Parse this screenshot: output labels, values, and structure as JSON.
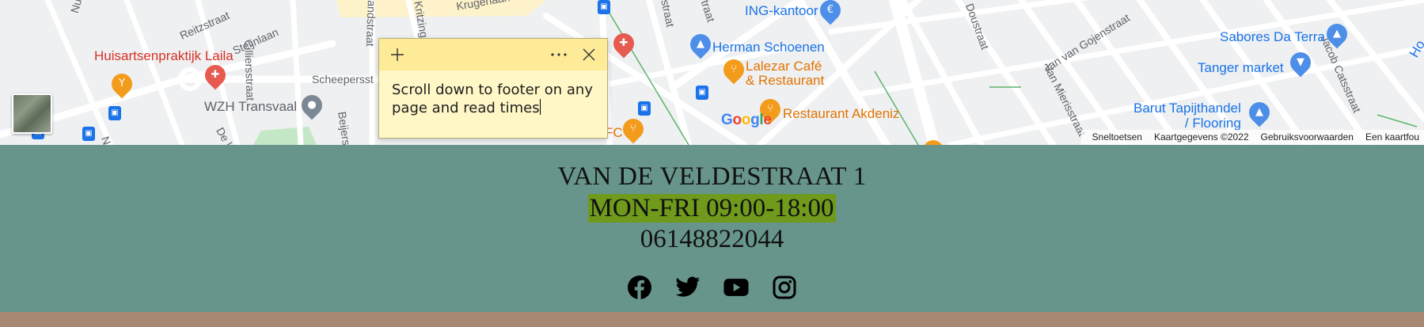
{
  "map": {
    "streets": [
      "Nunsp",
      "Reitzstraat",
      "Steijnlaan",
      "Cilliersstraat",
      "randstraat",
      "Kritzing",
      "Krugerlaan",
      "straat",
      "traat",
      "Doustraat",
      "Jan van Gojenstraat",
      "Van Mierisstraat",
      "Jacob Catsstraat",
      "Scheepersst",
      "Beijers",
      "De l",
      "N"
    ],
    "pois": {
      "laila": "Huisartsenpraktijk Laila",
      "wzh": "WZH Transvaal",
      "ing": "ING-kantoor",
      "herman": "Herman Schoenen",
      "lalezar": "Lalezar Café\n& Restaurant",
      "akdeniz": "Restaurant Akdeniz",
      "sabores": "Sabores Da Terra",
      "tanger": "Tanger market",
      "barut": "Barut Tapijthandel\n/ Flooring",
      "kfc_fragment": "FC",
      "hoo": "Ho"
    },
    "google_logo": "Google",
    "attribution": {
      "shortcuts": "Sneltoetsen",
      "map_data": "Kaartgegevens ©2022",
      "terms": "Gebruiksvoorwaarden",
      "report": "Een kaartfou"
    },
    "colors": {
      "background": "#eef0f2",
      "road": "#ffffff",
      "water": "#aadaff",
      "park": "#c4e8c6"
    }
  },
  "sticky_note": {
    "text": "Scroll down to footer on any page and read times",
    "add_icon": "+",
    "menu_icon": "···",
    "close_icon": "✕",
    "colors": {
      "bar": "#fdeb98",
      "body": "#fff7c6"
    }
  },
  "footer": {
    "address": "VAN DE VELDESTRAAT 1",
    "hours": "MON-FRI 09:00-18:00",
    "phone": "06148822044",
    "socials": [
      "facebook-icon",
      "twitter-icon",
      "youtube-icon",
      "instagram-icon"
    ],
    "colors": {
      "background": "#67958b",
      "highlight": "#6f9a1c",
      "page": "#a88872"
    }
  }
}
